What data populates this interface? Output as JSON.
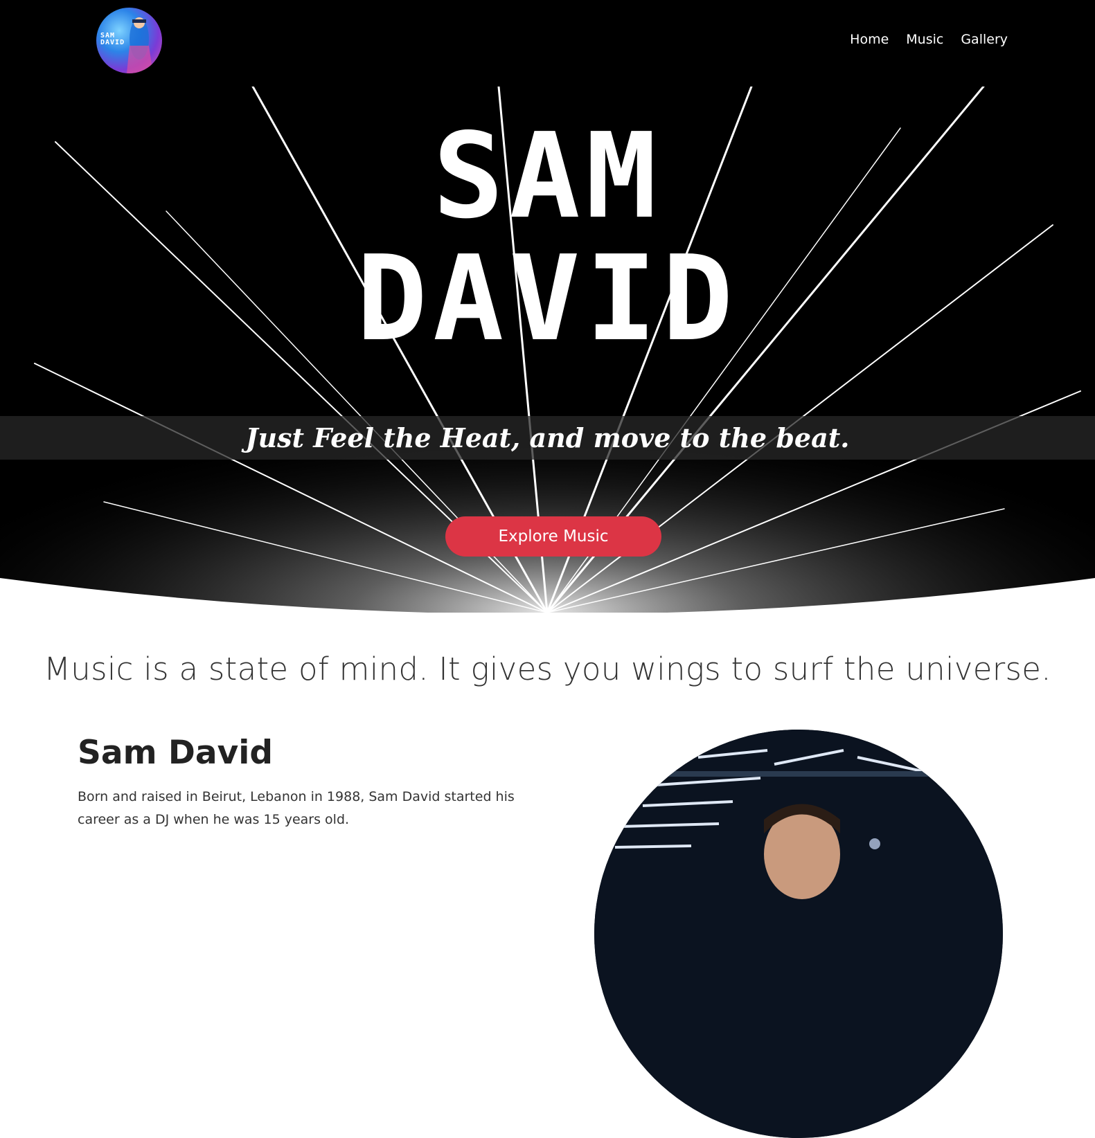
{
  "nav": {
    "logo_text": "SAM\nDAVID",
    "links": [
      "Home",
      "Music",
      "Gallery"
    ]
  },
  "hero": {
    "title_line1": "SAM",
    "title_line2": "DAVID",
    "tagline": "Just Feel the Heat, and move to the beat.",
    "cta_label": "Explore Music",
    "cta_color": "#dc3545"
  },
  "quote": "Music is a state of mind. It gives you wings to surf the universe.",
  "bio": {
    "heading": "Sam David",
    "text": "Born and raised in Beirut, Lebanon in 1988, Sam David started his career as a DJ when he was 15 years old."
  }
}
